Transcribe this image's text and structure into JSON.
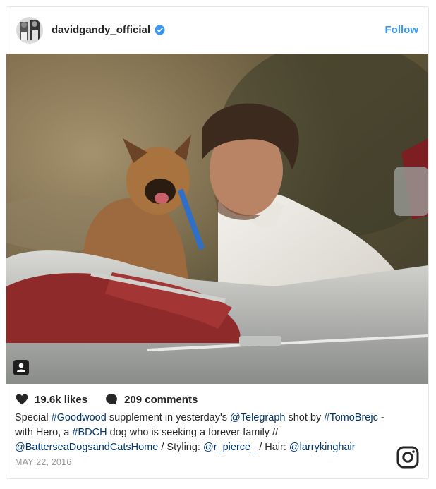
{
  "post": {
    "username": "davidgandy_official",
    "follow_label": "Follow",
    "likes": "19.6k likes",
    "comments": "209 comments",
    "caption": [
      {
        "text": "Special ",
        "type": "text"
      },
      {
        "text": "#Goodwood",
        "type": "tag"
      },
      {
        "text": " supplement in yesterday's ",
        "type": "text"
      },
      {
        "text": "@Telegraph",
        "type": "tag"
      },
      {
        "text": " shot by ",
        "type": "text"
      },
      {
        "text": "#TomoBrejc",
        "type": "tag"
      },
      {
        "text": " - with Hero, a ",
        "type": "text"
      },
      {
        "text": "#BDCH",
        "type": "tag"
      },
      {
        "text": " dog who is seeking a forever family // ",
        "type": "text"
      },
      {
        "text": "@BatterseaDogsandCatsHome",
        "type": "tag"
      },
      {
        "text": " / Styling: ",
        "type": "text"
      },
      {
        "text": "@r_pierce_",
        "type": "tag"
      },
      {
        "text": " / Hair: ",
        "type": "text"
      },
      {
        "text": "@larrykinghair",
        "type": "tag"
      }
    ],
    "date": "MAY 22, 2016"
  },
  "colors": {
    "link": "#003569",
    "follow": "#3897f0",
    "verified": "#3897f0",
    "muted": "#999999"
  },
  "icons": {
    "verified": "verified-badge-icon",
    "heart": "heart-icon",
    "comment": "comment-bubble-icon",
    "user_tag": "user-tag-icon",
    "logo": "instagram-logo-icon"
  }
}
